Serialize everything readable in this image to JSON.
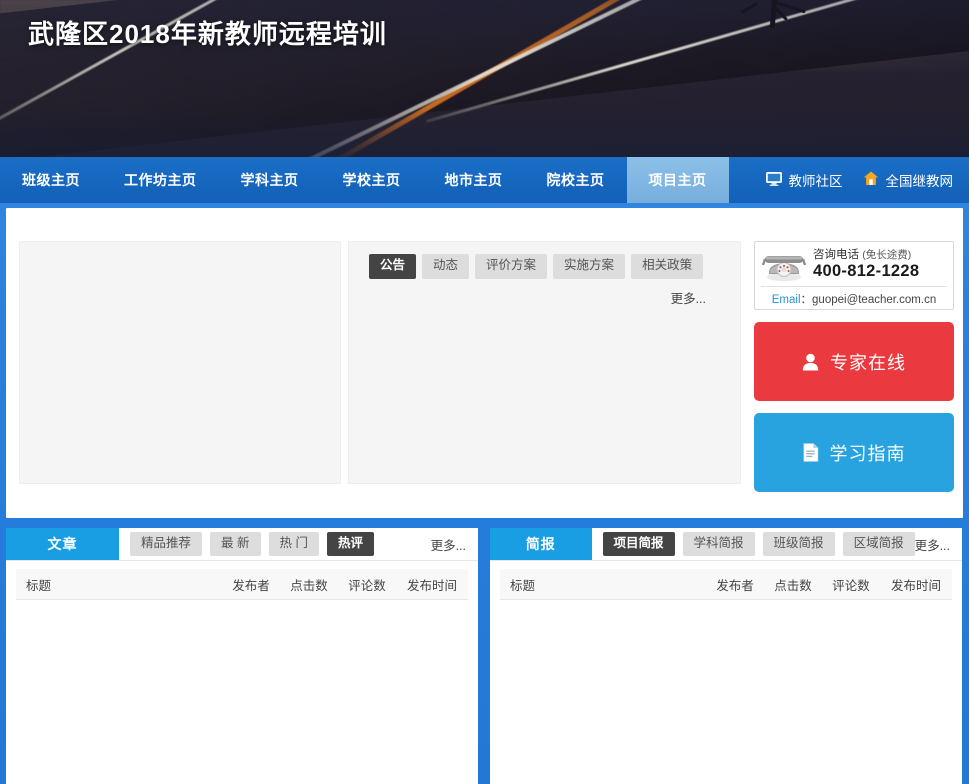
{
  "banner": {
    "title": "武隆区2018年新教师远程培训"
  },
  "nav": {
    "items": [
      {
        "label": "班级主页",
        "active": false
      },
      {
        "label": "工作坊主页",
        "active": false
      },
      {
        "label": "学科主页",
        "active": false
      },
      {
        "label": "学校主页",
        "active": false
      },
      {
        "label": "地市主页",
        "active": false
      },
      {
        "label": "院校主页",
        "active": false
      },
      {
        "label": "项目主页",
        "active": true
      }
    ],
    "right_links": [
      {
        "label": "教师社区",
        "icon": "monitor-icon"
      },
      {
        "label": "全国继教网",
        "icon": "house-icon"
      }
    ]
  },
  "notice_panel": {
    "tabs": [
      {
        "label": "公告",
        "active": true
      },
      {
        "label": "动态",
        "active": false
      },
      {
        "label": "评价方案",
        "active": false
      },
      {
        "label": "实施方案",
        "active": false
      },
      {
        "label": "相关政策",
        "active": false
      }
    ],
    "more": "更多..."
  },
  "contact": {
    "label_main": "咨询电话",
    "label_note": "(免长途费)",
    "phone": "400-812-1228",
    "email_label": "Email",
    "email_sep": "：",
    "email": "guopei@teacher.com.cn",
    "phone_icon": "telephone-icon"
  },
  "actions": [
    {
      "label": "专家在线",
      "icon": "user-icon",
      "color": "#ea3a3f"
    },
    {
      "label": "学习指南",
      "icon": "document-icon",
      "color": "#29a3e0"
    }
  ],
  "articles_panel": {
    "title": "文章",
    "tabs": [
      {
        "label": "精品推荐",
        "active": false
      },
      {
        "label": "最 新",
        "active": false
      },
      {
        "label": "热 门",
        "active": false
      },
      {
        "label": "热评",
        "active": true
      }
    ],
    "more": "更多...",
    "columns": [
      "标题",
      "发布者",
      "点击数",
      "评论数",
      "发布时间"
    ],
    "rows": []
  },
  "bulletins_panel": {
    "title": "简报",
    "tabs": [
      {
        "label": "项目简报",
        "active": true
      },
      {
        "label": "学科简报",
        "active": false
      },
      {
        "label": "班级简报",
        "active": false
      },
      {
        "label": "区域简报",
        "active": false
      }
    ],
    "more": "更多...",
    "columns": [
      "标题",
      "发布者",
      "点击数",
      "评论数",
      "发布时间"
    ],
    "rows": []
  },
  "colors": {
    "page_bg": "#2a80de",
    "nav_bg": "#1565c0",
    "nav_active": "#7cb4e0",
    "panel_title_blue": "#1a9ee3",
    "chip_active": "#444444",
    "expert_red": "#ea3a3f",
    "guide_blue": "#29a3e0"
  }
}
